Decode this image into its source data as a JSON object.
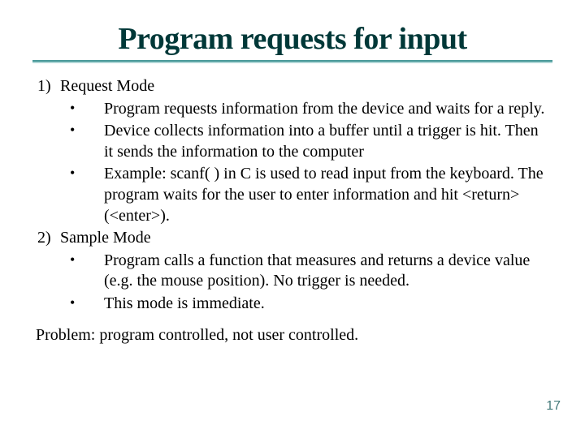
{
  "title": "Program requests for input",
  "items": [
    {
      "num": "1)",
      "label": "Request Mode",
      "sub": [
        "Program requests information from the device and waits for a reply.",
        "Device collects information into a buffer until a trigger is hit.  Then it sends the information to the computer",
        "Example: scanf( ) in C is used to read input from the keyboard.  The program waits for the user to enter information and hit <return> (<enter>)."
      ]
    },
    {
      "num": "2)",
      "label": "Sample Mode",
      "sub": [
        "Program calls a function that measures and returns a device value (e.g. the mouse position).  No trigger is needed.",
        "This mode is immediate."
      ]
    }
  ],
  "footer": "Problem: program controlled, not user controlled.",
  "page": "17"
}
